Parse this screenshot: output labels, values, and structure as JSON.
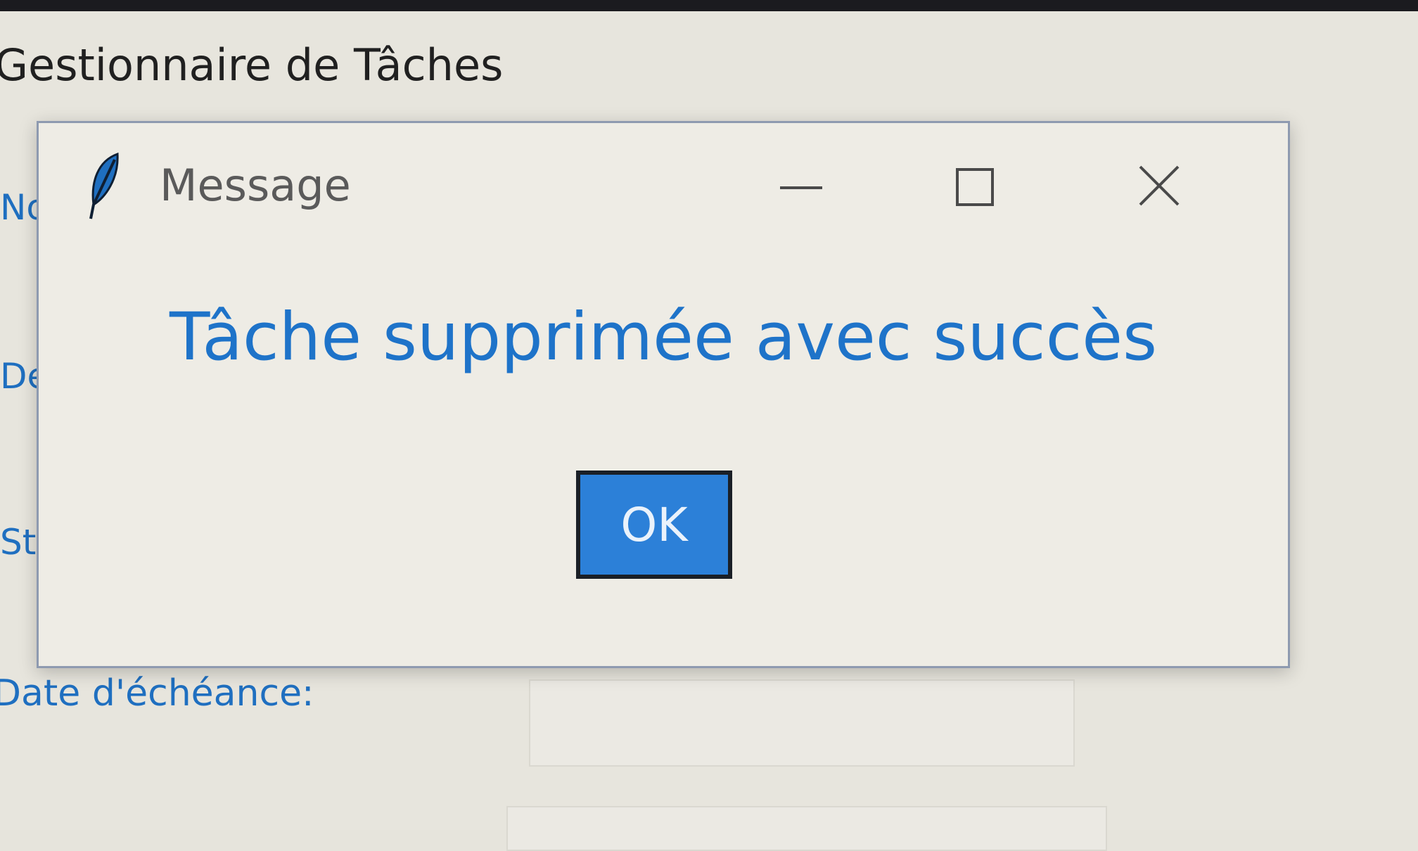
{
  "main_window": {
    "title": "Gestionnaire de Tâches",
    "field_labels": [
      "Nom",
      "Description",
      "Statut",
      "Date d'échéance:"
    ]
  },
  "dialog": {
    "title": "Message",
    "message": "Tâche supprimée avec succès",
    "ok_label": "OK"
  },
  "colors": {
    "accent": "#1e73c9",
    "button": "#2c80d8",
    "background": "#e7e5dd"
  }
}
